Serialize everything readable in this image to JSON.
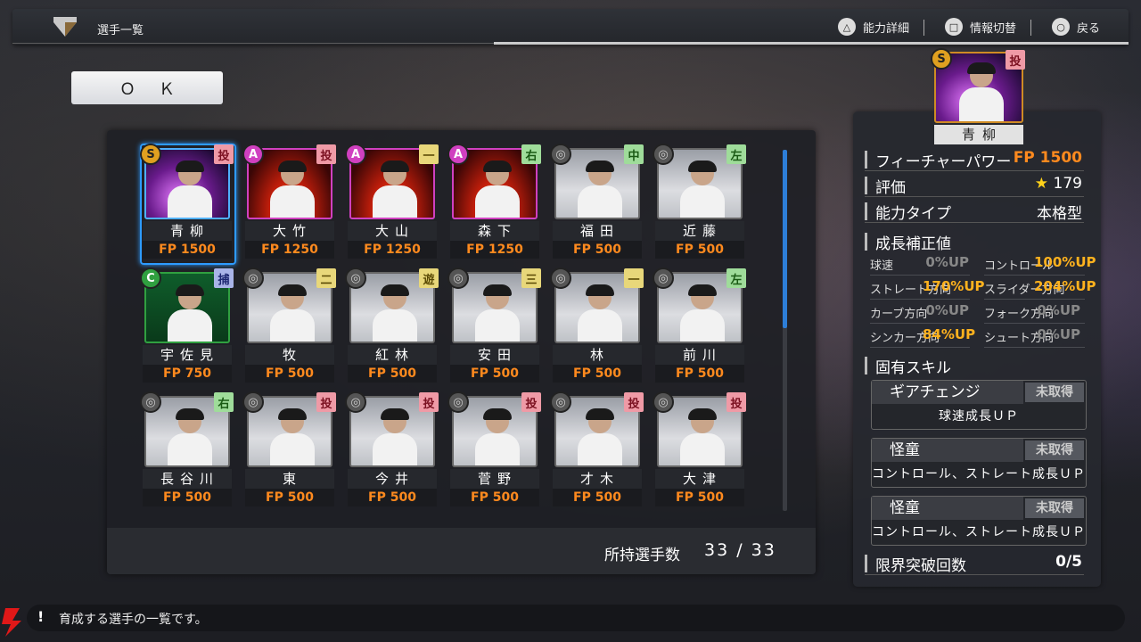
{
  "header": {
    "title": "選手一覧"
  },
  "hints": [
    {
      "icon_symbol": "△",
      "label": "能力詳細"
    },
    {
      "icon_symbol": "□",
      "label": "情報切替"
    },
    {
      "icon_symbol": "○",
      "label": "戻る"
    }
  ],
  "ok_button": {
    "label": "ＯＫ"
  },
  "players": [
    {
      "name": "青柳",
      "fp": "FP 1500",
      "rank": "S",
      "pos": "投",
      "style": "lightning"
    },
    {
      "name": "大竹",
      "fp": "FP 1250",
      "rank": "A",
      "pos": "投",
      "style": "fire"
    },
    {
      "name": "大山",
      "fp": "FP 1250",
      "rank": "A",
      "pos": "一",
      "style": "fire"
    },
    {
      "name": "森下",
      "fp": "FP 1250",
      "rank": "A",
      "pos": "右",
      "style": "fire"
    },
    {
      "name": "福田",
      "fp": "FP 500",
      "rank": "",
      "pos": "中",
      "style": "gray"
    },
    {
      "name": "近藤",
      "fp": "FP 500",
      "rank": "",
      "pos": "左",
      "style": "gray"
    },
    {
      "name": "宇佐見",
      "fp": "FP 750",
      "rank": "C",
      "pos": "捕",
      "style": "green"
    },
    {
      "name": "牧",
      "fp": "FP 500",
      "rank": "",
      "pos": "二",
      "style": "gray"
    },
    {
      "name": "紅林",
      "fp": "FP 500",
      "rank": "",
      "pos": "遊",
      "style": "gray"
    },
    {
      "name": "安田",
      "fp": "FP 500",
      "rank": "",
      "pos": "三",
      "style": "gray"
    },
    {
      "name": "林",
      "fp": "FP 500",
      "rank": "",
      "pos": "一",
      "style": "gray"
    },
    {
      "name": "前川",
      "fp": "FP 500",
      "rank": "",
      "pos": "左",
      "style": "gray"
    },
    {
      "name": "長谷川",
      "fp": "FP 500",
      "rank": "",
      "pos": "右",
      "style": "gray"
    },
    {
      "name": "東",
      "fp": "FP 500",
      "rank": "",
      "pos": "投",
      "style": "gray"
    },
    {
      "name": "今井",
      "fp": "FP 500",
      "rank": "",
      "pos": "投",
      "style": "gray"
    },
    {
      "name": "菅野",
      "fp": "FP 500",
      "rank": "",
      "pos": "投",
      "style": "gray"
    },
    {
      "name": "才木",
      "fp": "FP 500",
      "rank": "",
      "pos": "投",
      "style": "gray"
    },
    {
      "name": "大津",
      "fp": "FP 500",
      "rank": "",
      "pos": "投",
      "style": "gray"
    }
  ],
  "roster_count": {
    "label": "所持選手数",
    "value": "33 / 33"
  },
  "detail": {
    "name": "青柳",
    "rank": "S",
    "pos": "投",
    "future_power_label": "フィーチャーパワー",
    "future_power_value": "FP 1500",
    "rating_label": "評価",
    "rating_value": "179",
    "type_label": "能力タイプ",
    "type_value": "本格型",
    "growth_label": "成長補正値",
    "growth": [
      {
        "label": "球速",
        "value": "0%UP"
      },
      {
        "label": "コントロール",
        "value": "100%UP"
      },
      {
        "label": "ストレート方向",
        "value": "170%UP"
      },
      {
        "label": "スライダー方向",
        "value": "204%UP"
      },
      {
        "label": "カーブ方向",
        "value": "0%UP"
      },
      {
        "label": "フォーク方向",
        "value": "0%UP"
      },
      {
        "label": "シンカー方向",
        "value": "84%UP"
      },
      {
        "label": "シュート方向",
        "value": "0%UP"
      }
    ],
    "skills_label": "固有スキル",
    "skills": [
      {
        "name": "ギアチェンジ",
        "status": "未取得",
        "desc": "球速成長ＵＰ"
      },
      {
        "name": "怪童",
        "status": "未取得",
        "desc": "コントロール、ストレート成長ＵＰ"
      },
      {
        "name": "怪童",
        "status": "未取得",
        "desc": "コントロール、ストレート成長ＵＰ"
      }
    ],
    "limit_label": "限界突破回数",
    "limit_value": "0/5"
  },
  "bottom_message": "育成する選手の一覧です。",
  "colors": {
    "accent_orange": "#ff8a1e",
    "select_blue": "#2e9bff",
    "rank_s": "#e0a020",
    "rank_a": "#d040c0",
    "rank_c": "#30a040"
  }
}
